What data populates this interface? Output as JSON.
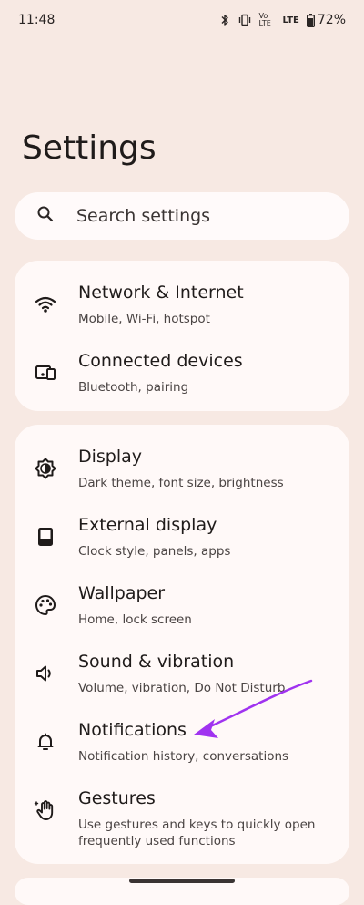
{
  "status_bar": {
    "time": "11:48",
    "network_label": "LTE",
    "volte_label": "Vo LTE",
    "battery_percent": "72%"
  },
  "page": {
    "title": "Settings"
  },
  "search": {
    "placeholder": "Search settings"
  },
  "groups": [
    {
      "items": [
        {
          "title": "Network & Internet",
          "subtitle": "Mobile, Wi-Fi, hotspot",
          "icon": "wifi-icon"
        },
        {
          "title": "Connected devices",
          "subtitle": "Bluetooth, pairing",
          "icon": "devices-icon"
        }
      ]
    },
    {
      "items": [
        {
          "title": "Display",
          "subtitle": "Dark theme, font size, brightness",
          "icon": "brightness-icon"
        },
        {
          "title": "External display",
          "subtitle": "Clock style, panels, apps",
          "icon": "external-display-icon"
        },
        {
          "title": "Wallpaper",
          "subtitle": "Home, lock screen",
          "icon": "palette-icon"
        },
        {
          "title": "Sound & vibration",
          "subtitle": "Volume, vibration, Do Not Disturb",
          "icon": "speaker-icon"
        },
        {
          "title": "Notifications",
          "subtitle": "Notification history, conversations",
          "icon": "bell-icon"
        },
        {
          "title": "Gestures",
          "subtitle": "Use gestures and keys to quickly open frequently used functions",
          "icon": "gesture-hand-icon"
        }
      ]
    }
  ],
  "colors": {
    "background": "#f7e9e3",
    "card": "#fff9f8",
    "annotation_arrow": "#a033f0"
  }
}
